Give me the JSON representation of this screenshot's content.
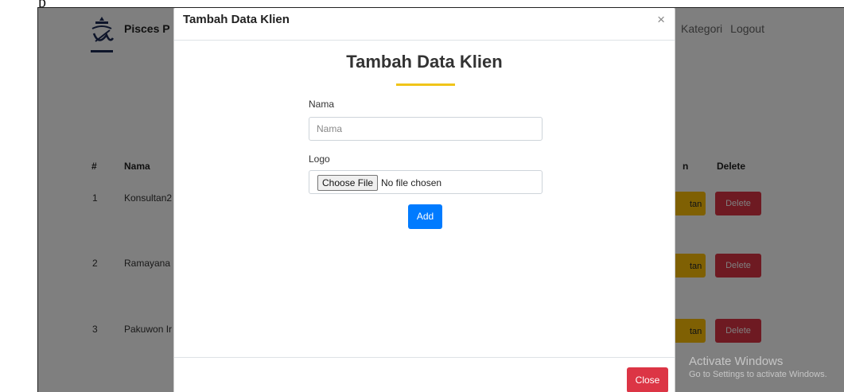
{
  "crop_text": "p",
  "header": {
    "brand": "Pisces P",
    "nav": [
      "Kategori",
      "Logout"
    ]
  },
  "table": {
    "headers": {
      "index": "#",
      "name": "Nama",
      "action": "n",
      "delete": "Delete"
    },
    "rows": [
      {
        "index": "1",
        "name": "Konsultan2",
        "action": "tan",
        "delete": "Delete"
      },
      {
        "index": "2",
        "name": "Ramayana",
        "action": "tan",
        "delete": "Delete"
      },
      {
        "index": "3",
        "name": "Pakuwon Ir",
        "action": "tan",
        "delete": "Delete"
      }
    ]
  },
  "modal": {
    "title": "Tambah Data Klien",
    "close_icon": "×",
    "heading": "Tambah Data Klien",
    "fields": {
      "name_label": "Nama",
      "name_placeholder": "Nama",
      "logo_label": "Logo",
      "file_button": "Choose File",
      "file_status": "No file chosen"
    },
    "add_button": "Add",
    "close_button": "Close"
  },
  "watermark": {
    "title": "Activate Windows",
    "subtitle": "Go to Settings to activate Windows."
  },
  "colors": {
    "primary": "#007bff",
    "danger": "#dc3545",
    "warning": "#ffc107",
    "accent_bar": "#f0c419"
  }
}
